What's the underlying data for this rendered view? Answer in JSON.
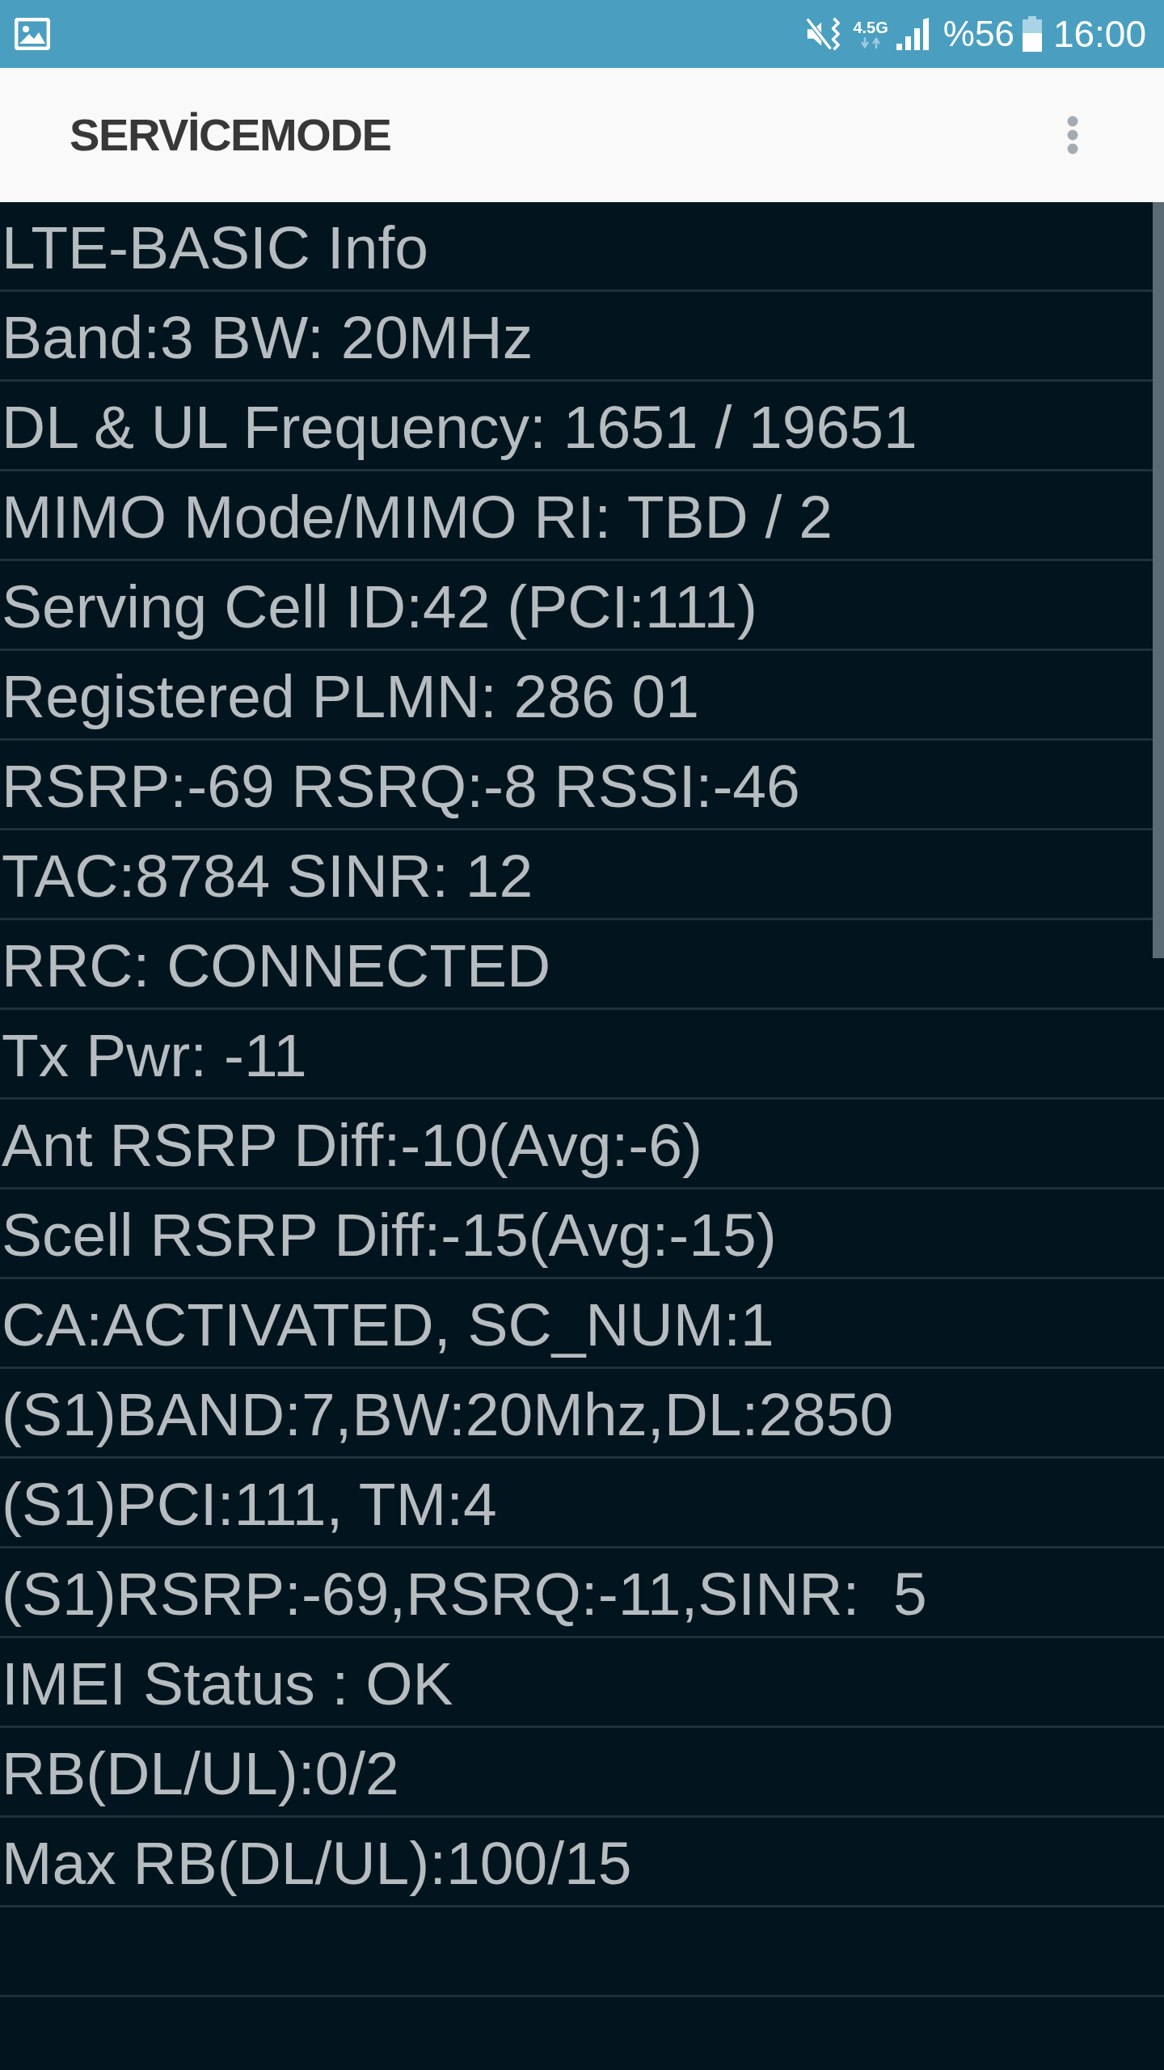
{
  "status_bar": {
    "network_type": "4.5G",
    "battery_percent": "%56",
    "time": "16:00"
  },
  "app_bar": {
    "title": "SERVİCEMODE"
  },
  "info_lines": [
    "LTE-BASIC Info",
    "Band:3 BW: 20MHz",
    "DL & UL Frequency: 1651 / 19651",
    "MIMO Mode/MIMO RI: TBD / 2",
    "Serving Cell ID:42 (PCI:111)",
    "Registered PLMN: 286 01",
    "RSRP:-69 RSRQ:-8 RSSI:-46",
    "TAC:8784 SINR: 12",
    "RRC: CONNECTED",
    "Tx Pwr: -11",
    "Ant RSRP Diff:-10(Avg:-6)",
    "Scell RSRP Diff:-15(Avg:-15)",
    "CA:ACTIVATED, SC_NUM:1",
    "(S1)BAND:7,BW:20Mhz,DL:2850",
    "(S1)PCI:111, TM:4",
    "(S1)RSRP:-69,RSRQ:-11,SINR:  5",
    "IMEI Status : OK",
    "RB(DL/UL):0/2",
    "Max RB(DL/UL):100/15"
  ]
}
